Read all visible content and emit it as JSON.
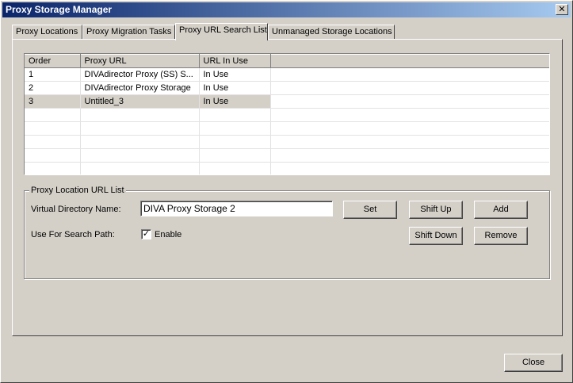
{
  "window": {
    "title": "Proxy Storage Manager",
    "close_glyph": "✕"
  },
  "tabs": [
    {
      "label": "Proxy Locations"
    },
    {
      "label": "Proxy Migration Tasks"
    },
    {
      "label": "Proxy URL Search List",
      "active": true
    },
    {
      "label": "Unmanaged Storage Locations"
    }
  ],
  "grid": {
    "columns": [
      "Order",
      "Proxy URL",
      "URL In Use"
    ],
    "rows": [
      {
        "order": "1",
        "url": "DIVAdirector Proxy (SS) S...",
        "in_use": "In Use"
      },
      {
        "order": "2",
        "url": "DIVAdirector Proxy Storage",
        "in_use": "In Use"
      },
      {
        "order": "3",
        "url": "Untitled_3",
        "in_use": "In Use",
        "selected": true
      }
    ]
  },
  "group": {
    "title": "Proxy Location URL List",
    "virtual_dir_label": "Virtual Directory Name:",
    "virtual_dir_value": "DIVA Proxy Storage 2",
    "search_path_label": "Use For Search Path:",
    "enable_label": "Enable",
    "enable_checked": true,
    "check_glyph": "✓",
    "buttons": {
      "set": "Set",
      "shift_up": "Shift Up",
      "add": "Add",
      "shift_down": "Shift Down",
      "remove": "Remove"
    }
  },
  "footer": {
    "close": "Close"
  }
}
